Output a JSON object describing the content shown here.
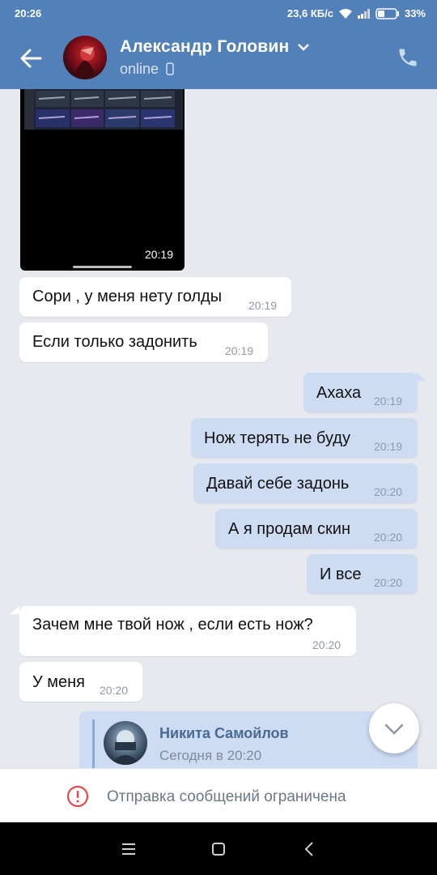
{
  "status_bar": {
    "time": "20:26",
    "speed": "23,6 КБ/с",
    "battery": "33%"
  },
  "header": {
    "title": "Александр Головин",
    "status": "online",
    "icons": [
      "back-arrow-icon",
      "chevron-down-icon",
      "mobile-icon",
      "phone-icon"
    ]
  },
  "media_message": {
    "time": "20:19"
  },
  "messages": [
    {
      "dir": "in",
      "text": "Сори , у меня нету голды",
      "time": "20:19"
    },
    {
      "dir": "in",
      "text": "Если только задонить",
      "time": "20:19"
    },
    {
      "dir": "out",
      "text": "Ахаха",
      "time": "20:19"
    },
    {
      "dir": "out",
      "text": "Нож терять не буду",
      "time": "20:19"
    },
    {
      "dir": "out",
      "text": "Давай себе задонь",
      "time": "20:20"
    },
    {
      "dir": "out",
      "text": "А я продам скин",
      "time": "20:20"
    },
    {
      "dir": "out",
      "text": "И все",
      "time": "20:20"
    },
    {
      "dir": "in",
      "text": "Зачем мне твой нож , если есть нож?",
      "time": "20:20"
    },
    {
      "dir": "in",
      "text": "У меня",
      "time": "20:20"
    }
  ],
  "reply_preview": {
    "name": "Никита Самойлов",
    "date": "Сегодня в 20:20"
  },
  "bottom_notice": {
    "text": "Отправка сообщений ограничена"
  },
  "colors": {
    "accent": "#5181b8",
    "outgoing": "#cddcf3",
    "warning": "#e64646"
  }
}
